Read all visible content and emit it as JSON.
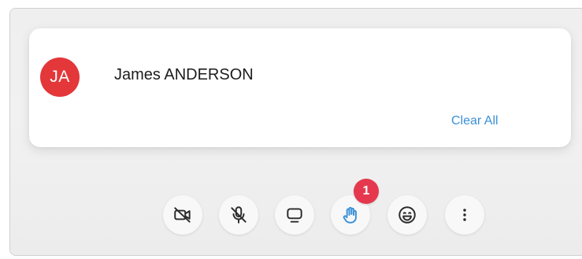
{
  "notification": {
    "avatar_initials": "JA",
    "participant_name": "James ANDERSON",
    "clear_all_label": "Clear All"
  },
  "controls": {
    "raise_hand_badge_count": "1",
    "icons": [
      "video-off-icon",
      "mic-off-icon",
      "screen-share-icon",
      "raise-hand-icon",
      "emoji-icon",
      "more-options-icon"
    ]
  },
  "colors": {
    "avatar": "#e3373a",
    "link": "#3a91d8",
    "raise_hand_active": "#3a91d8",
    "badge": "#e5384e",
    "icon": "#2a2a2a"
  }
}
